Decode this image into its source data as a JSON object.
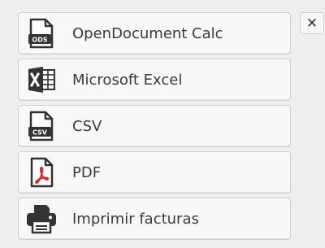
{
  "export_menu": {
    "items": [
      {
        "label": "OpenDocument Calc",
        "icon": "ods-file-icon",
        "badge": "ODS"
      },
      {
        "label": "Microsoft Excel",
        "icon": "excel-icon"
      },
      {
        "label": "CSV",
        "icon": "csv-file-icon",
        "badge": "CSV"
      },
      {
        "label": "PDF",
        "icon": "pdf-file-icon"
      },
      {
        "label": "Imprimir facturas",
        "icon": "printer-icon"
      }
    ]
  },
  "close_button": {
    "symbol": "✕",
    "icon": "close-icon"
  },
  "colors": {
    "icon_dark": "#333333",
    "pdf_red": "#d9272e",
    "button_bg": "#f8f8f8",
    "button_border": "#cfcfcf",
    "background": "#efefef"
  }
}
